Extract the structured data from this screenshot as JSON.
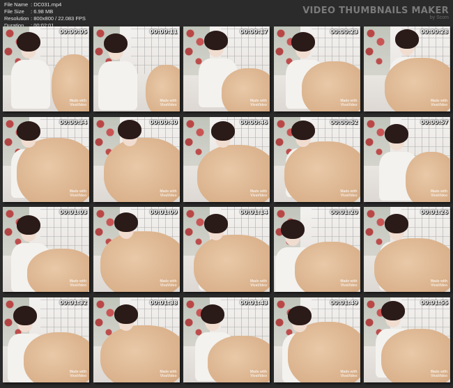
{
  "file_info": [
    {
      "key": "File Name",
      "value": ": DC031.mp4"
    },
    {
      "key": "File Size",
      "value": ": 6.98 MB"
    },
    {
      "key": "Resolution",
      "value": ": 800x800 / 22.083 FPS"
    },
    {
      "key": "Duration",
      "value": ": 00:02:01"
    }
  ],
  "brand": {
    "title": "VIDEO THUMBNAILS MAKER",
    "subtitle": "by Scom"
  },
  "watermark": {
    "line1": "Made with",
    "line2": "VivaVideo"
  },
  "thumbnails": [
    {
      "time": "00:00:05",
      "scene": "a"
    },
    {
      "time": "00:00:11",
      "scene": "b"
    },
    {
      "time": "00:00:17",
      "scene": "c"
    },
    {
      "time": "00:00:23",
      "scene": "d"
    },
    {
      "time": "00:00:28",
      "scene": "e"
    },
    {
      "time": "00:00:34",
      "scene": "f"
    },
    {
      "time": "00:00:40",
      "scene": "g"
    },
    {
      "time": "00:00:46",
      "scene": "h"
    },
    {
      "time": "00:00:52",
      "scene": "i"
    },
    {
      "time": "00:00:57",
      "scene": "j"
    },
    {
      "time": "00:01:03",
      "scene": "k"
    },
    {
      "time": "00:01:09",
      "scene": "l"
    },
    {
      "time": "00:01:14",
      "scene": "m"
    },
    {
      "time": "00:01:20",
      "scene": "n"
    },
    {
      "time": "00:01:26",
      "scene": "o"
    },
    {
      "time": "00:01:32",
      "scene": "p"
    },
    {
      "time": "00:01:38",
      "scene": "q"
    },
    {
      "time": "00:01:43",
      "scene": "r"
    },
    {
      "time": "00:01:49",
      "scene": "s"
    },
    {
      "time": "00:01:55",
      "scene": "t"
    }
  ]
}
